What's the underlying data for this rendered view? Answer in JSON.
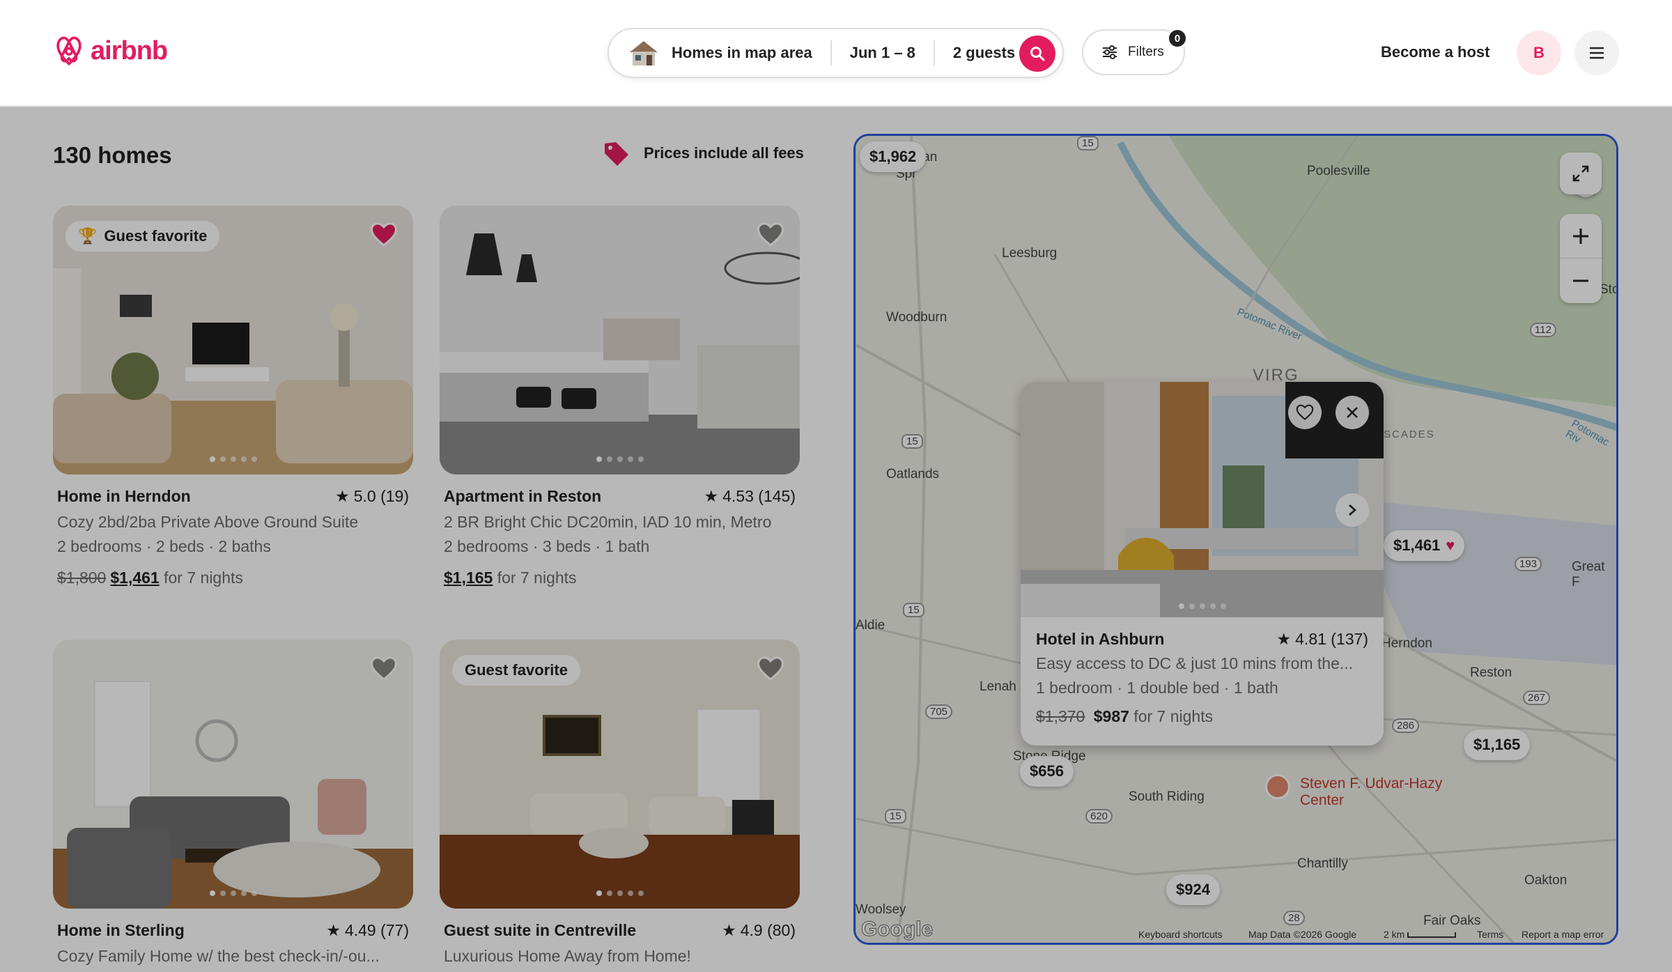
{
  "header": {
    "logo_text": "airbnb",
    "search": {
      "location": "Homes in map area",
      "dates": "Jun 1 – 8",
      "guests": "2 guests"
    },
    "filters_label": "Filters",
    "filters_count": "0",
    "host_link": "Become a host",
    "avatar_initial": "B"
  },
  "listings_header": {
    "count": "130 homes",
    "fees_note": "Prices include all fees"
  },
  "cards": [
    {
      "badge": "Guest favorite",
      "favorited": true,
      "title": "Home in Herndon",
      "rating": "5.0 (19)",
      "subtitle": "Cozy 2bd/2ba Private Above Ground Suite",
      "details": "2 bedrooms · 2 beds · 2 baths",
      "old_price": "$1,800",
      "price": "$1,461",
      "price_suffix": "for 7 nights"
    },
    {
      "badge": "",
      "favorited": false,
      "title": "Apartment in Reston",
      "rating": "4.53 (145)",
      "subtitle": "2 BR Bright Chic DC20min, IAD 10 min, Metro",
      "details": "2 bedrooms · 3 beds · 1 bath",
      "old_price": "",
      "price": "$1,165",
      "price_suffix": "for 7 nights"
    },
    {
      "badge": "",
      "favorited": false,
      "title": "Home in Sterling",
      "rating": "4.49 (77)",
      "subtitle": "Cozy Family Home w/ the best check-in/-ou...",
      "details": "",
      "old_price": "",
      "price": "",
      "price_suffix": ""
    },
    {
      "badge": "Guest favorite",
      "favorited": false,
      "title": "Guest suite in Centreville",
      "rating": "4.9 (80)",
      "subtitle": "Luxurious Home Away from Home!",
      "details": "",
      "old_price": "",
      "price": "",
      "price_suffix": ""
    }
  ],
  "map": {
    "pins": [
      "$1,962",
      "$1,461",
      "$1,165",
      "$656",
      "$924"
    ],
    "pin_partial": "6",
    "places": [
      "Poolesville",
      "Leesburg",
      "Woodburn",
      "Oatlands",
      "Aldie",
      "Lenah",
      "Stone Ridge",
      "South Riding",
      "Chantilly",
      "Woolsey",
      "Fair Oaks",
      "Oakton",
      "Herndon",
      "Reston",
      "Great F",
      "Sto",
      "VIRG",
      "SCADES",
      "Potomac River",
      "Potomac Riv",
      "ian",
      "Spr"
    ],
    "landmark": "Steven F. Udvar-Hazy Center",
    "route_shields": [
      "15",
      "15",
      "15",
      "15",
      "112",
      "193",
      "267",
      "286",
      "620",
      "705",
      "28"
    ],
    "footer": {
      "shortcuts": "Keyboard shortcuts",
      "data": "Map Data ©2026 Google",
      "scale": "2 km",
      "terms": "Terms",
      "report": "Report a map error"
    },
    "google": "Google",
    "popup": {
      "title": "Hotel in Ashburn",
      "rating": "4.81 (137)",
      "subtitle": "Easy access to DC & just 10 mins from the...",
      "details": "1 bedroom · 1 double bed · 1 bath",
      "old_price": "$1,370",
      "price": "$987",
      "price_suffix": "for 7 nights"
    }
  },
  "colors": {
    "brand": "#e31c5f",
    "map_border": "#2a5bd7",
    "text": "#222222",
    "muted": "#6a6a6a"
  }
}
